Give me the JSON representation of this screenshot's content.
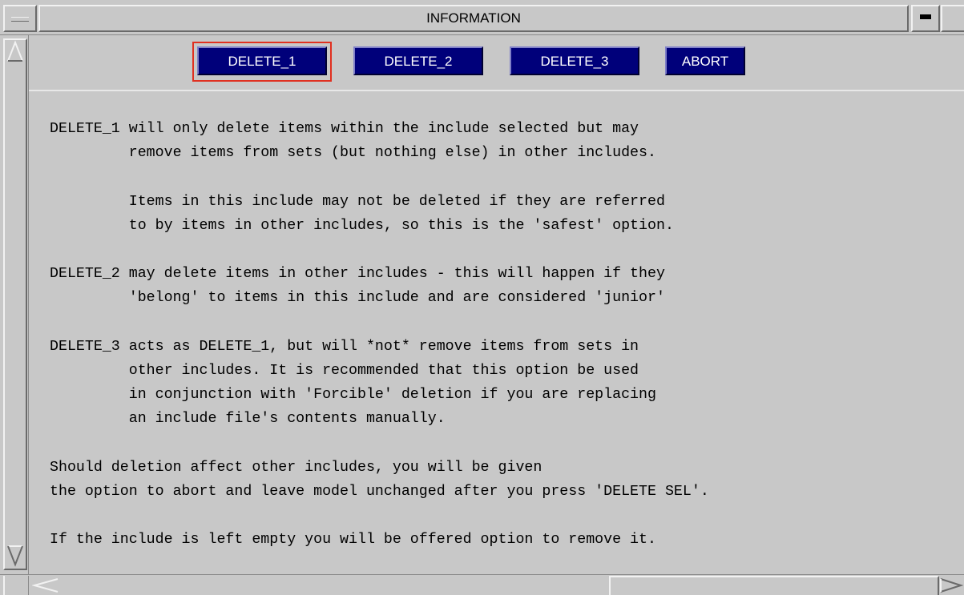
{
  "window": {
    "title": "INFORMATION",
    "menu_icon": "window-menu-icon",
    "minimize_icon": "minimize-icon",
    "maximize_icon": "maximize-icon"
  },
  "buttons": {
    "delete_1": "DELETE_1",
    "delete_2": "DELETE_2",
    "delete_3": "DELETE_3",
    "abort": "ABORT",
    "focused": "DELETE_1"
  },
  "info_text": "DELETE_1 will only delete items within the include selected but may\n         remove items from sets (but nothing else) in other includes.\n\n         Items in this include may not be deleted if they are referred\n         to by items in other includes, so this is the 'safest' option.\n\nDELETE_2 may delete items in other includes - this will happen if they\n         'belong' to items in this include and are considered 'junior'\n\nDELETE_3 acts as DELETE_1, but will *not* remove items from sets in\n         other includes. It is recommended that this option be used\n         in conjunction with 'Forcible' deletion if you are replacing\n         an include file's contents manually.\n\nShould deletion affect other includes, you will be given\nthe option to abort and leave model unchanged after you press 'DELETE SEL'.\n\nIf the include is left empty you will be offered option to remove it.",
  "colors": {
    "background": "#c8c8c8",
    "button_bg": "#00007a",
    "button_text": "#ffffff",
    "focus_outline": "#e03020"
  }
}
